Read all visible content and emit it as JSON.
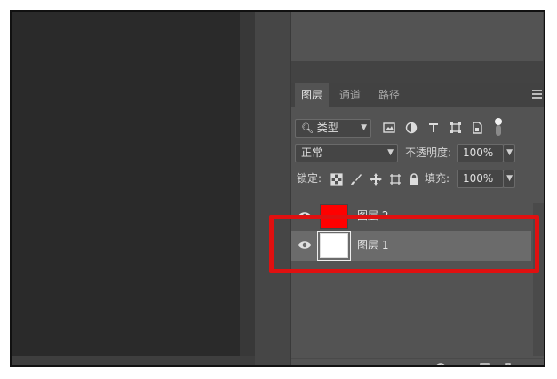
{
  "tabs": [
    {
      "label": "图层",
      "active": true
    },
    {
      "label": "通道",
      "active": false
    },
    {
      "label": "路径",
      "active": false
    }
  ],
  "filter": {
    "kind_label": "类型"
  },
  "blend": {
    "mode": "正常",
    "opacity_label": "不透明度:",
    "opacity_value": "100%"
  },
  "lock": {
    "label": "锁定:",
    "fill_label": "填充:",
    "fill_value": "100%"
  },
  "layers": [
    {
      "name": "图层 2",
      "thumb_color": "#ff0000",
      "selected": false
    },
    {
      "name": "图层 1",
      "thumb_color": "#ffffff",
      "selected": true
    }
  ],
  "colors": {
    "highlight": "#e01010",
    "panel": "#535353",
    "selected_row": "#6b6b6b"
  }
}
